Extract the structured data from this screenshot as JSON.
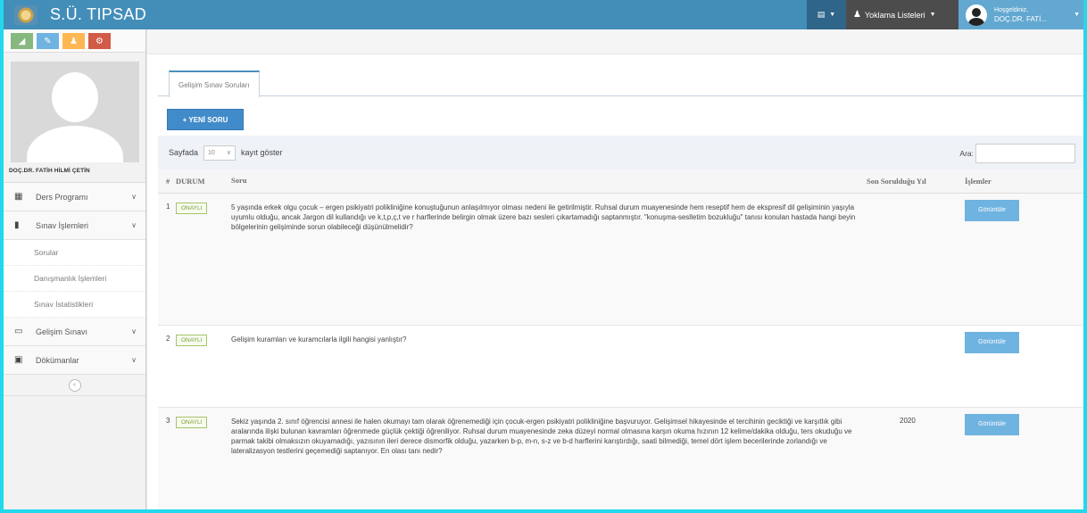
{
  "brand": {
    "title": "S.Ü. TIPSAD"
  },
  "navbar": {
    "tasks_icon": "list-icon",
    "yoklama_label": "Yoklama Listeleri",
    "user_greeting": "Hoşgeldiniz,",
    "user_name": "DOÇ.DR. FATİ..."
  },
  "sidebar": {
    "shortcuts": [
      "signal-icon",
      "pencil-icon",
      "users-icon",
      "cogs-icon"
    ],
    "profile_name": "DOÇ.DR. FATİH HİLMİ ÇETİN",
    "items": [
      {
        "label": "Ders Programı",
        "icon": "calendar-icon"
      },
      {
        "label": "Sınav İşlemleri",
        "icon": "book-icon"
      },
      {
        "label": "Gelişim Sınavı",
        "icon": "desktop-icon"
      },
      {
        "label": "Dökümanlar",
        "icon": "folder-icon"
      }
    ],
    "submenu": [
      "Sorular",
      "Danışmanlık İşlemleri",
      "Sınav İstatistikleri"
    ]
  },
  "main": {
    "tab_label": "Gelişim Sınav Soruları",
    "new_button": "+ YENİ SORU",
    "length_prefix": "Sayfada",
    "length_value": "10",
    "length_suffix": "kayıt göster",
    "search_label": "Ara:",
    "columns": [
      "#",
      "DURUM",
      "Soru",
      "Son Sorulduğu Yıl",
      "İşlemler"
    ],
    "rows": [
      {
        "num": "1",
        "status": "ONAYLI",
        "question": "5 yaşında erkek olgu çocuk – ergen psikiyatri polikliniğine konuştuğunun anlaşılmıyor olması nedeni ile getirilmiştir. Ruhsal durum muayenesinde hem reseptif hem de ekspresif dil gelişiminin yaşıyla uyumlu olduğu, ancak Jargon dil kullandığı ve k,t,p,ç,t ve r harflerinde belirgin olmak üzere bazı sesleri çıkartamadığı saptanmıştır. \"konuşma-seslletim bozukluğu\" tanısı konulan hastada hangi beyin bölgelerinin gelişiminde sorun olabileceği düşünülmelidir?",
        "year": "",
        "action": "Görüntüle"
      },
      {
        "num": "2",
        "status": "ONAYLI",
        "question": "Gelişim kuramları ve kuramcılarla ilgili hangisi yanlıştır?",
        "year": "",
        "action": "Görüntüle"
      },
      {
        "num": "3",
        "status": "ONAYLI",
        "question": "Sekiz yaşında 2. sınıf öğrencisi annesi ile halen okumayı tam olarak öğrenemediği için çocuk-ergen psikiyatri polikliniğine başvuruyor. Gelişimsel hikayesinde el tercihinin geciktiği ve karşıtlık gibi aralarında ilişki bulunan kavramları öğrenmede güçlük çektiği öğreniliyor. Ruhsal durum muayenesinde zeka düzeyi normal olmasına karşın okuma hızının 12 kelime/dakika olduğu, ters okuduğu ve parmak takibi olmaksızın okuyamadığı, yazısının ileri derece dismorfik olduğu, yazarken b-p, m-n, s-z ve b-d harflerini karıştırdığı, saati bilmediği, temel dört işlem becerilerinde zorlandığı ve lateralizasyon testlerini geçemediği saptanıyor. En olası tanı nedir?",
        "year": "2020",
        "action": "Görüntüle"
      }
    ]
  },
  "colors": {
    "navbar": "#438eb9",
    "accent": "#428bca",
    "view_button": "#6fb3e0",
    "badge_green": "#7aa03a",
    "frame": "#22d8ec"
  }
}
